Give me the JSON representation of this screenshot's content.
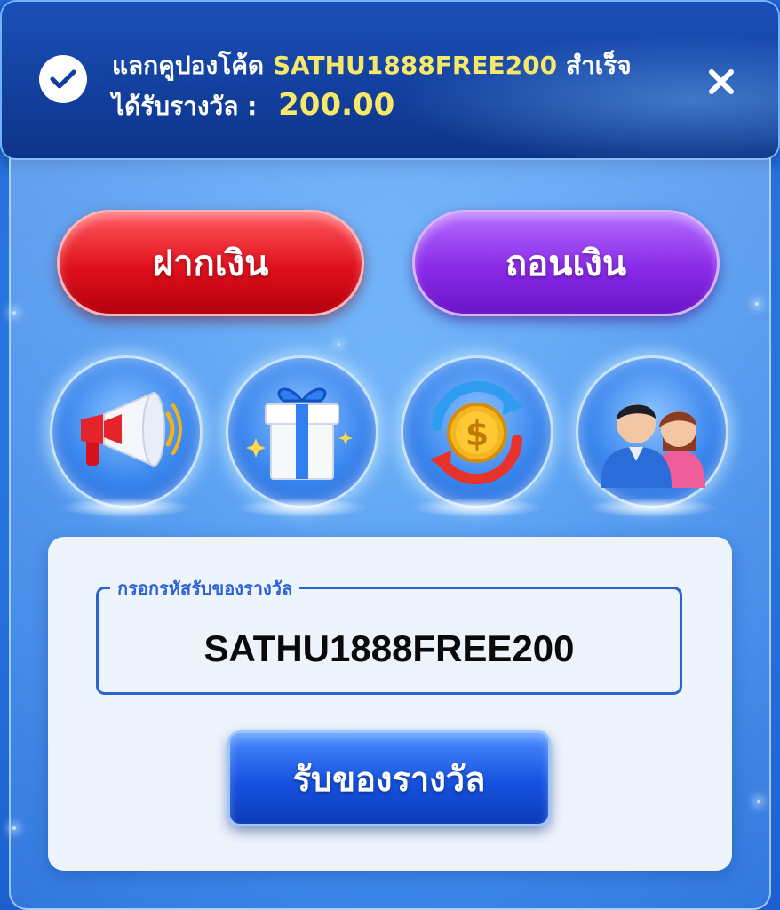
{
  "toast": {
    "prefix": "แลกคูปองโค้ด",
    "code": "SATHU1888FREE200",
    "suffix": "สำเร็จ",
    "reward_label": "ได้รับรางวัล :",
    "reward_amount": "200.00",
    "icons": [
      "check-circle-icon",
      "close-icon"
    ]
  },
  "actions": {
    "deposit_label": "ฝากเงิน",
    "withdraw_label": "ถอนเงิน"
  },
  "shortcuts": [
    {
      "icon": "megaphone-icon"
    },
    {
      "icon": "gift-box-icon"
    },
    {
      "icon": "currency-exchange-icon"
    },
    {
      "icon": "users-icon"
    }
  ],
  "redeem": {
    "field_label": "กรอกรหัสรับของรางวัล",
    "field_value": "SATHU1888FREE200",
    "button_label": "รับของรางวัล"
  },
  "colors": {
    "deposit": "#e0101d",
    "withdraw": "#8a2be8",
    "primary": "#1652e0",
    "highlight": "#f8e86a"
  }
}
